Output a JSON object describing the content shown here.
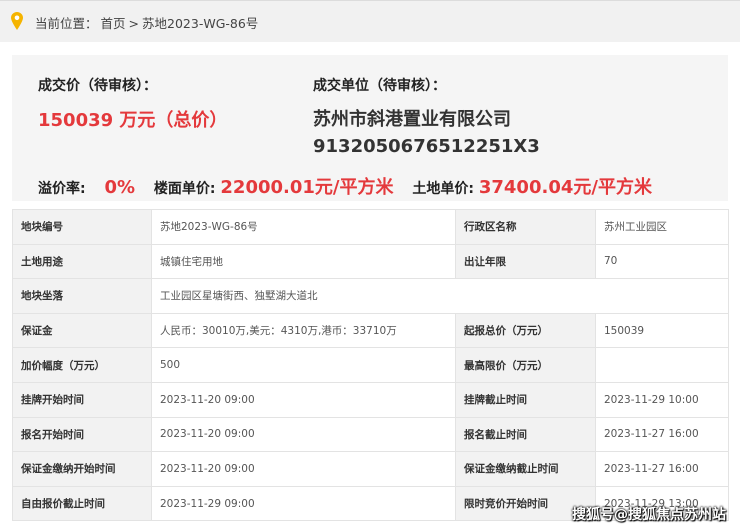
{
  "breadcrumb": {
    "prefix": "当前位置：",
    "home": "首页",
    "sep": ">",
    "current": "苏地2023-WG-86号"
  },
  "summary": {
    "price_label": "成交价（待审核）：",
    "price_value": "150039 万元（总价）",
    "winner_label": "成交单位（待审核）：",
    "winner_name": "苏州市斜港置业有限公司",
    "winner_code": "913205067651225​1X3",
    "premium_label": "溢价率:",
    "premium_value": "0%",
    "floor_price_label": "楼面单价:",
    "floor_price_value": "22000.01元/平方米",
    "land_price_label": "土地单价:",
    "land_price_value": "37400.04元/平方米"
  },
  "table": {
    "rows": [
      [
        "地块编号",
        "苏地2023-WG-86号",
        "行政区名称",
        "苏州工业园区"
      ],
      [
        "土地用途",
        "城镇住宅用地",
        "出让年限",
        "70"
      ],
      [
        "地块坐落",
        "工业园区星塘街西、独墅湖大道北",
        "",
        ""
      ],
      [
        "保证金",
        "人民币：30010万,美元：4310万,港币：33710万",
        "起报总价（万元）",
        "150039"
      ],
      [
        "加价幅度（万元）",
        "500",
        "最高限价（万元）",
        ""
      ],
      [
        "挂牌开始时间",
        "2023-11-20 09:00",
        "挂牌截止时间",
        "2023-11-29 10:00"
      ],
      [
        "报名开始时间",
        "2023-11-20 09:00",
        "报名截止时间",
        "2023-11-27 16:00"
      ],
      [
        "保证金缴纳开始时间",
        "2023-11-20 09:00",
        "保证金缴纳截止时间",
        "2023-11-27 16:00"
      ],
      [
        "自由报价截止时间",
        "2023-11-29 09:00",
        "限时竞价开始时间",
        "2023-11-29 13:00"
      ]
    ]
  },
  "watermark": "搜狐号@搜狐焦点苏州站",
  "colors": {
    "accent": "#e4393c",
    "pin": "#f5b400"
  }
}
